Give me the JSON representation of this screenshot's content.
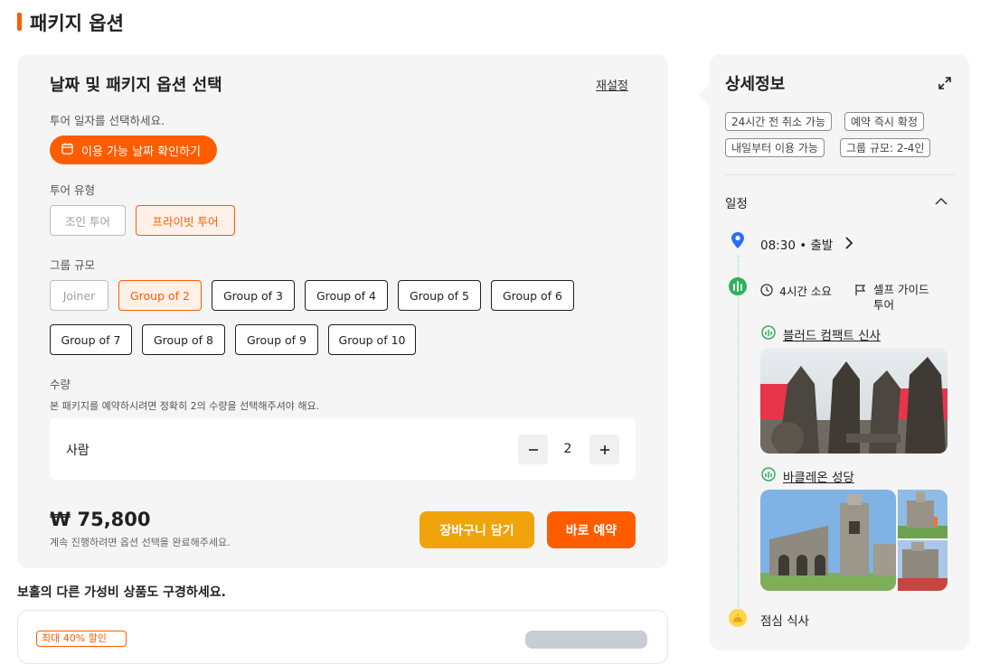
{
  "page": {
    "title": "패키지 옵션"
  },
  "options": {
    "title": "날짜 및 패키지 옵션 선택",
    "reset": "재설정",
    "date_prompt": "투어 일자를 선택하세요.",
    "date_button": "이용 가능 날짜 확인하기",
    "tour_type_label": "투어 유형",
    "tour_types": [
      {
        "label": "조인 투어",
        "state": "disabled"
      },
      {
        "label": "프라이빗 투어",
        "state": "selected"
      }
    ],
    "group_label": "그룹 규모",
    "groups": [
      {
        "label": "Joiner",
        "state": "disabled"
      },
      {
        "label": "Group of 2",
        "state": "selected"
      },
      {
        "label": "Group of 3",
        "state": "normal"
      },
      {
        "label": "Group of 4",
        "state": "normal"
      },
      {
        "label": "Group of 5",
        "state": "normal"
      },
      {
        "label": "Group of 6",
        "state": "normal"
      },
      {
        "label": "Group of 7",
        "state": "normal"
      },
      {
        "label": "Group of 8",
        "state": "normal"
      },
      {
        "label": "Group of 9",
        "state": "normal"
      },
      {
        "label": "Group of 10",
        "state": "normal"
      }
    ],
    "quantity_label": "수량",
    "quantity_note": "본 패키지를 예약하시려면 정확히 2의 수량을 선택해주셔야 해요.",
    "person_label": "사람",
    "quantity_value": "2",
    "price": "₩ 75,800",
    "price_note": "계속 진행하려면 옵션 선택을 완료해주세요.",
    "cart_button": "장바구니 담기",
    "book_button": "바로 예약"
  },
  "promo": {
    "text": "보홀의 다른 가성비 상품도 구경하세요.",
    "badge": "최대 40% 할인"
  },
  "details": {
    "title": "상세정보",
    "tags": [
      "24시간 전 취소 가능",
      "예약 즉시 확정",
      "내일부터 이용 가능",
      "그룹 규모: 2-4인"
    ],
    "schedule_label": "일정",
    "departure": "08:30 • 출발",
    "duration": "4시간 소요",
    "guide_line1": "셀프 가이드",
    "guide_line2": "투어",
    "stop1": "블러드 컴팩트 신사",
    "stop2": "바클레온 성당",
    "lunch": "점심 식사"
  },
  "colors": {
    "accent": "#ff5c00",
    "cart": "#f0a30a",
    "panel": "#f5f5f5",
    "timeline": "#8fd6a3"
  }
}
